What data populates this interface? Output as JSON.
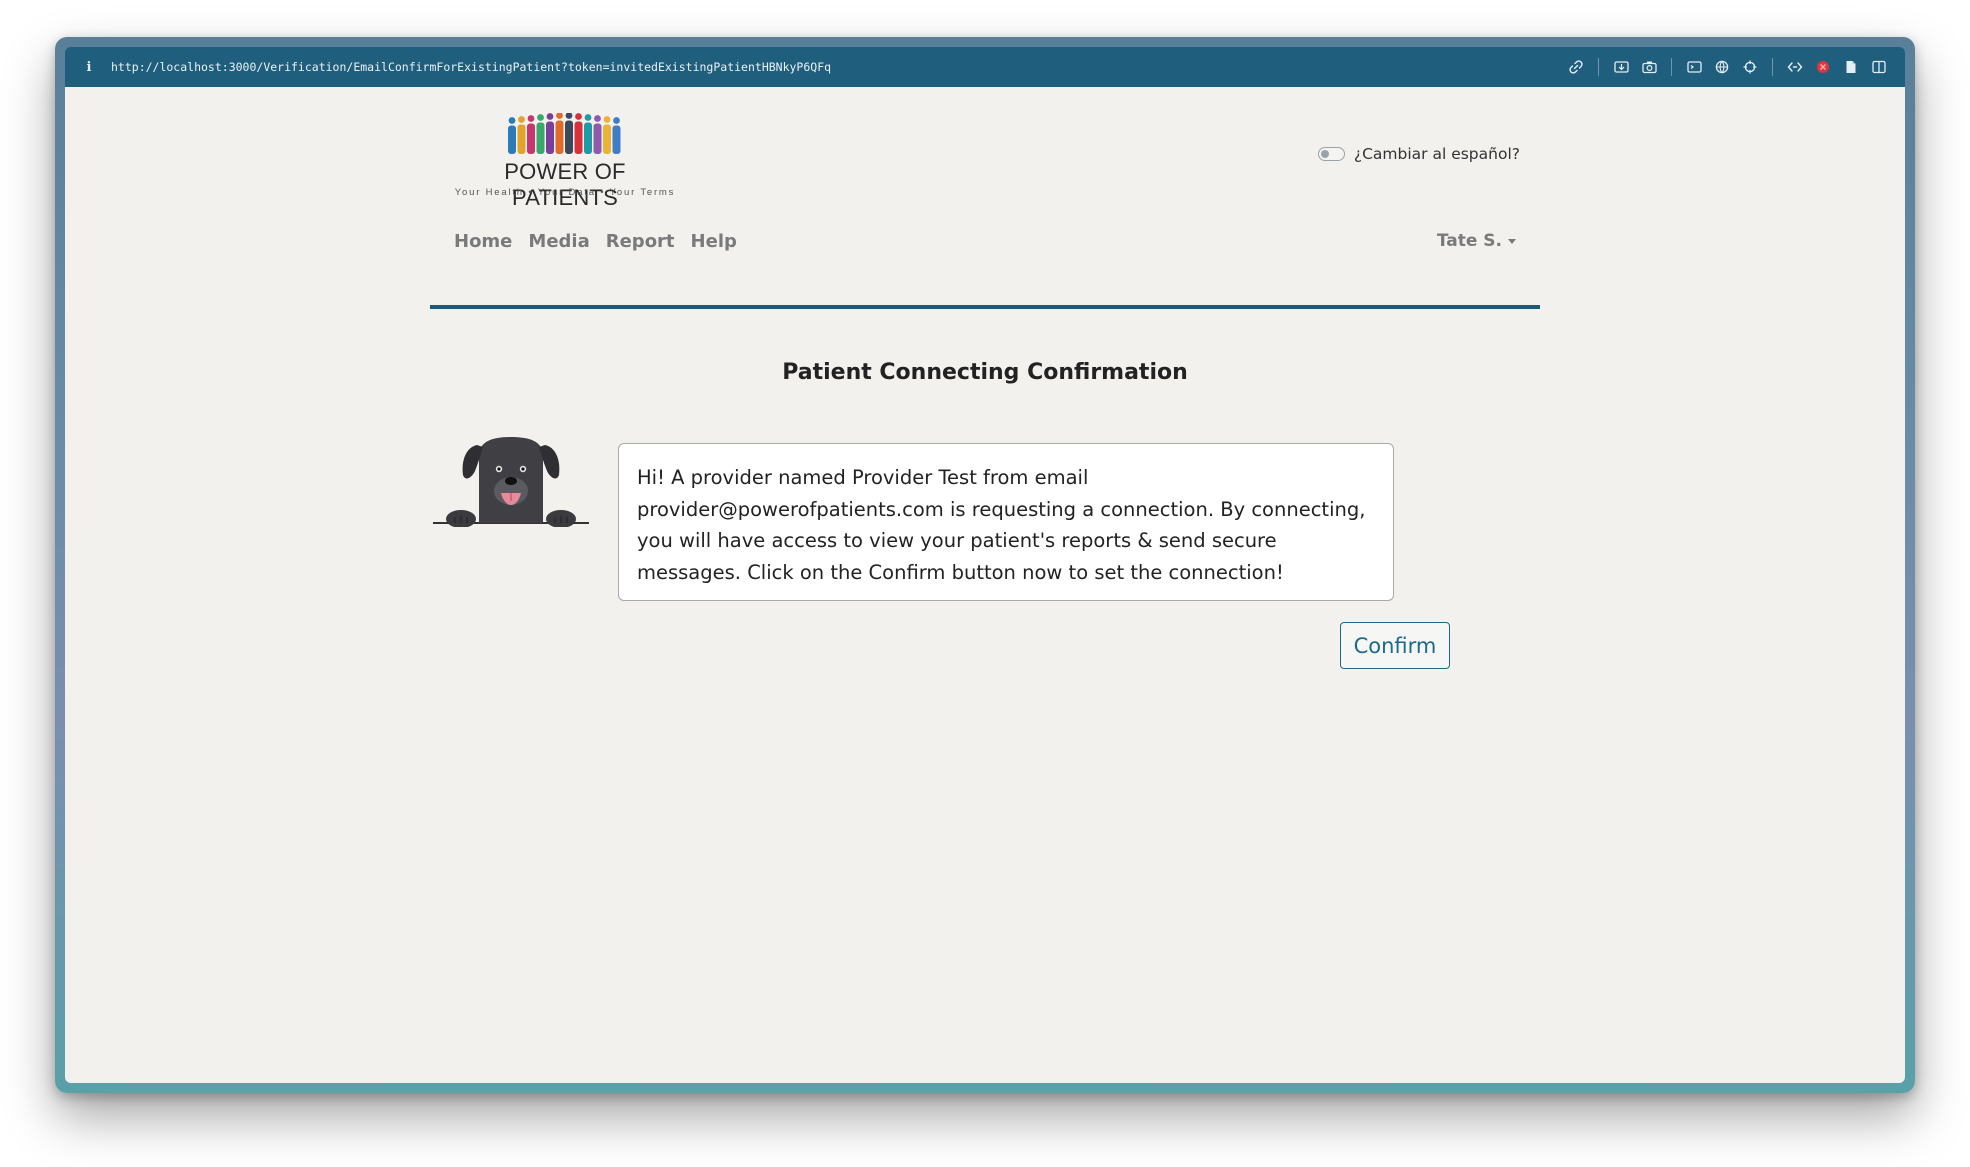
{
  "browser": {
    "url": "http://localhost:3000/Verification/EmailConfirmForExistingPatient?token=invitedExistingPatientHBNkyP6QFq",
    "info_symbol": "i",
    "toolbar_icons": [
      "link-icon",
      "screenshot-icon",
      "camera-icon",
      "terminal-icon",
      "globe-icon",
      "crosshair-icon",
      "code-icon",
      "record-icon",
      "document-icon",
      "sidebar-icon"
    ]
  },
  "logo": {
    "title": "POWER OF PATIENTS",
    "tagline": "Your Health • Your Data • Your Terms",
    "figure_colors": [
      "#2b7bb9",
      "#e0a32e",
      "#c6376f",
      "#39a96b",
      "#7a3f98",
      "#e06b2b",
      "#3a4a5a",
      "#d9303d",
      "#1f9aa7",
      "#8c5bb0",
      "#e9b338",
      "#3f7ec4"
    ]
  },
  "language": {
    "label": "¿Cambiar al español?",
    "enabled": false
  },
  "nav": {
    "items": [
      "Home",
      "Media",
      "Report",
      "Help"
    ],
    "user_label": "Tate S."
  },
  "colors": {
    "accent": "#1b5a7b",
    "page_bg": "#f2f1ed"
  },
  "main": {
    "title": "Patient Connecting Confirmation",
    "message": "Hi! A provider named Provider Test from email provider@powerofpatients.com is requesting a connection. By connecting, you will have access to view your patient's reports & send secure messages. Click on the Confirm button now to set the connection!",
    "confirm_label": "Confirm"
  }
}
